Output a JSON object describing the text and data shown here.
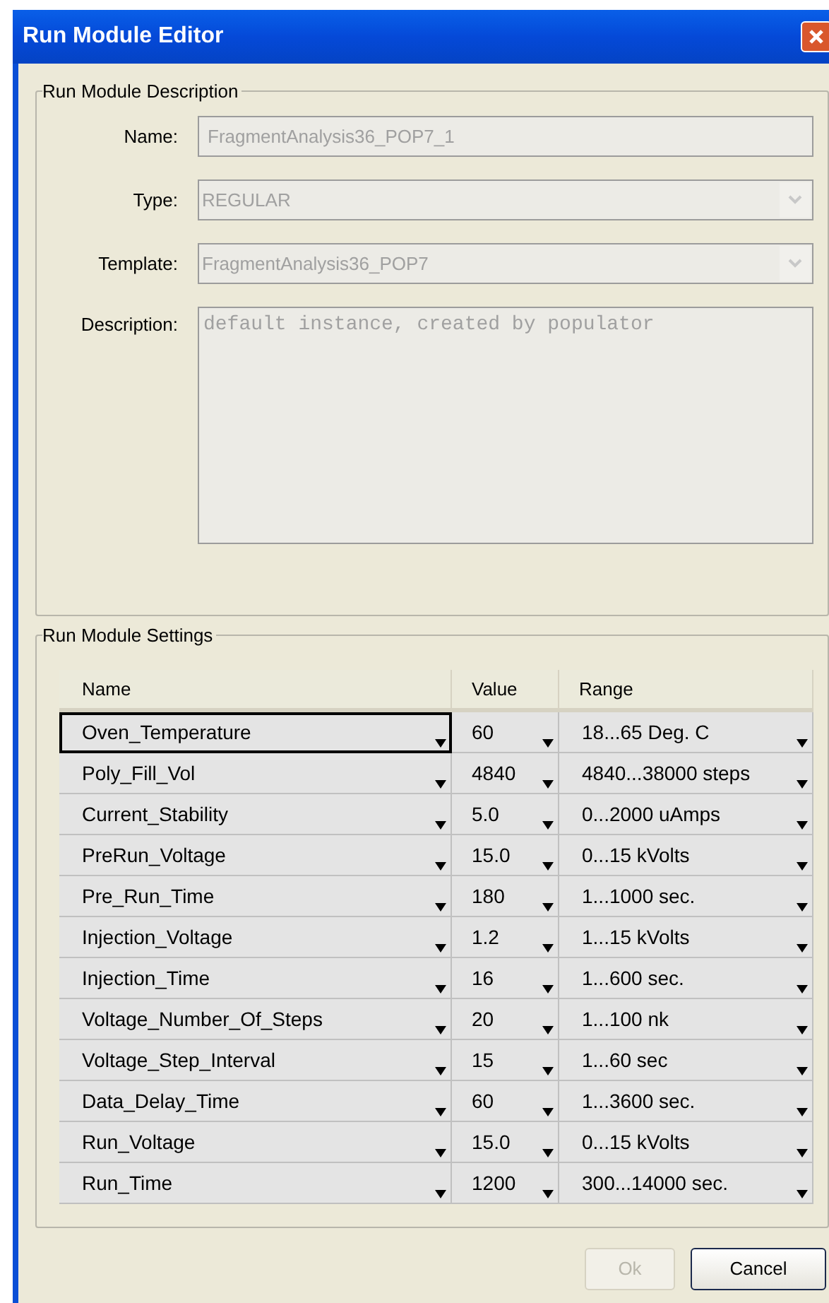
{
  "window": {
    "title": "Run Module Editor"
  },
  "description_group": {
    "title": "Run Module Description",
    "fields": [
      {
        "kind": "text",
        "label": "Name:",
        "value": "FragmentAnalysis36_POP7_1",
        "disabled": true
      },
      {
        "kind": "combo",
        "label": "Type:",
        "value": "REGULAR",
        "disabled": true
      },
      {
        "kind": "combo",
        "label": "Template:",
        "value": "FragmentAnalysis36_POP7",
        "disabled": true
      },
      {
        "kind": "area",
        "label": "Description:",
        "value": "default instance, created by populator",
        "disabled": true
      }
    ]
  },
  "settings_group": {
    "title": "Run Module Settings",
    "table": {
      "columns": [
        "Name",
        "Value",
        "Range"
      ],
      "rows": [
        {
          "name": "Oven_Temperature",
          "value": "60",
          "range": "18...65 Deg. C",
          "selected": true
        },
        {
          "name": "Poly_Fill_Vol",
          "value": "4840",
          "range": "4840...38000 steps",
          "selected": false
        },
        {
          "name": "Current_Stability",
          "value": "5.0",
          "range": "0...2000 uAmps",
          "selected": false
        },
        {
          "name": "PreRun_Voltage",
          "value": "15.0",
          "range": "0...15 kVolts",
          "selected": false
        },
        {
          "name": "Pre_Run_Time",
          "value": "180",
          "range": "1...1000 sec.",
          "selected": false
        },
        {
          "name": "Injection_Voltage",
          "value": "1.2",
          "range": "1...15 kVolts",
          "selected": false
        },
        {
          "name": "Injection_Time",
          "value": "16",
          "range": "1...600 sec.",
          "selected": false
        },
        {
          "name": "Voltage_Number_Of_Steps",
          "value": "20",
          "range": "1...100 nk",
          "selected": false
        },
        {
          "name": "Voltage_Step_Interval",
          "value": "15",
          "range": "1...60 sec",
          "selected": false
        },
        {
          "name": "Data_Delay_Time",
          "value": "60",
          "range": "1...3600 sec.",
          "selected": false
        },
        {
          "name": "Run_Voltage",
          "value": "15.0",
          "range": "0...15 kVolts",
          "selected": false
        },
        {
          "name": "Run_Time",
          "value": "1200",
          "range": "300...14000 sec.",
          "selected": false
        }
      ]
    }
  },
  "buttons": [
    {
      "label": "Ok",
      "disabled": true
    },
    {
      "label": "Cancel",
      "disabled": false
    }
  ]
}
